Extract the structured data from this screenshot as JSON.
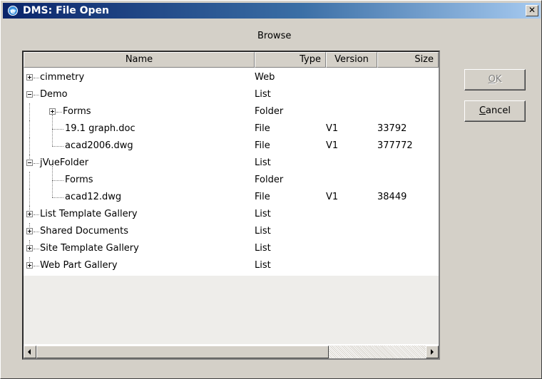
{
  "window": {
    "title": "DMS: File Open",
    "close_glyph": "✕",
    "title_icon": "ie-globe-icon"
  },
  "browse_label": "Browse",
  "columns": {
    "name": "Name",
    "type": "Type",
    "version": "Version",
    "size": "Size"
  },
  "rows": [
    {
      "name": "cimmetry",
      "type": "Web",
      "version": "",
      "size": ""
    },
    {
      "name": "Demo",
      "type": "List",
      "version": "",
      "size": ""
    },
    {
      "name": "Forms",
      "type": "Folder",
      "version": "",
      "size": ""
    },
    {
      "name": "19.1 graph.doc",
      "type": "File",
      "version": "V1",
      "size": "33792"
    },
    {
      "name": "acad2006.dwg",
      "type": "File",
      "version": "V1",
      "size": "377772"
    },
    {
      "name": "jVueFolder",
      "type": "List",
      "version": "",
      "size": ""
    },
    {
      "name": "Forms",
      "type": "Folder",
      "version": "",
      "size": ""
    },
    {
      "name": "acad12.dwg",
      "type": "File",
      "version": "V1",
      "size": "38449"
    },
    {
      "name": "List Template Gallery",
      "type": "List",
      "version": "",
      "size": ""
    },
    {
      "name": "Shared Documents",
      "type": "List",
      "version": "",
      "size": ""
    },
    {
      "name": "Site Template Gallery",
      "type": "List",
      "version": "",
      "size": ""
    },
    {
      "name": "Web Part Gallery",
      "type": "List",
      "version": "",
      "size": ""
    }
  ],
  "buttons": {
    "ok_mnemonic": "O",
    "ok_rest": "K",
    "cancel_mnemonic": "C",
    "cancel_rest": "ancel"
  },
  "colors": {
    "titlebar_start": "#0a246a",
    "titlebar_end": "#a6caf0",
    "dialog_bg": "#d4d0c8"
  }
}
